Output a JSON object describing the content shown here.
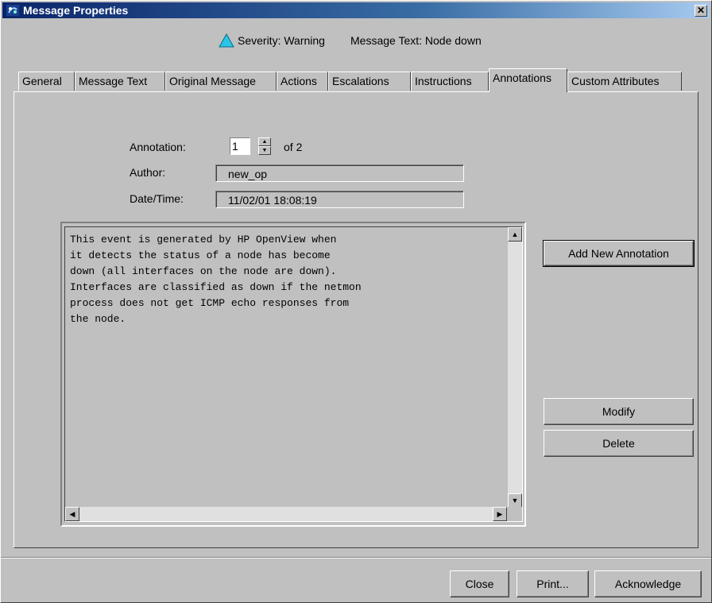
{
  "window": {
    "title": "Message Properties"
  },
  "header": {
    "severity_text": "Severity: Warning",
    "message_text": "Message Text: Node down",
    "severity_color": "#29c5e6"
  },
  "tabs": [
    {
      "label": "General",
      "selected": false
    },
    {
      "label": "Message Text",
      "selected": false
    },
    {
      "label": "Original Message",
      "selected": false
    },
    {
      "label": "Actions",
      "selected": false
    },
    {
      "label": "Escalations",
      "selected": false
    },
    {
      "label": "Instructions",
      "selected": false
    },
    {
      "label": "Annotations",
      "selected": true
    },
    {
      "label": "Custom Attributes",
      "selected": false
    }
  ],
  "annotation": {
    "annotation_label": "Annotation:",
    "index_value": "1",
    "of_text": "of 2",
    "author_label": "Author:",
    "author_value": "new_op",
    "datetime_label": "Date/Time:",
    "datetime_value": "11/02/01 18:08:19",
    "text": "This event is generated by HP OpenView when\nit detects the status of a node has become\ndown (all interfaces on the node are down).\nInterfaces are classified as down if the netmon\nprocess does not get ICMP echo responses from\nthe node."
  },
  "side_buttons": {
    "add_new": "Add New Annotation",
    "modify": "Modify",
    "delete": "Delete"
  },
  "bottom_buttons": {
    "close": "Close",
    "print": "Print...",
    "acknowledge": "Acknowledge"
  }
}
